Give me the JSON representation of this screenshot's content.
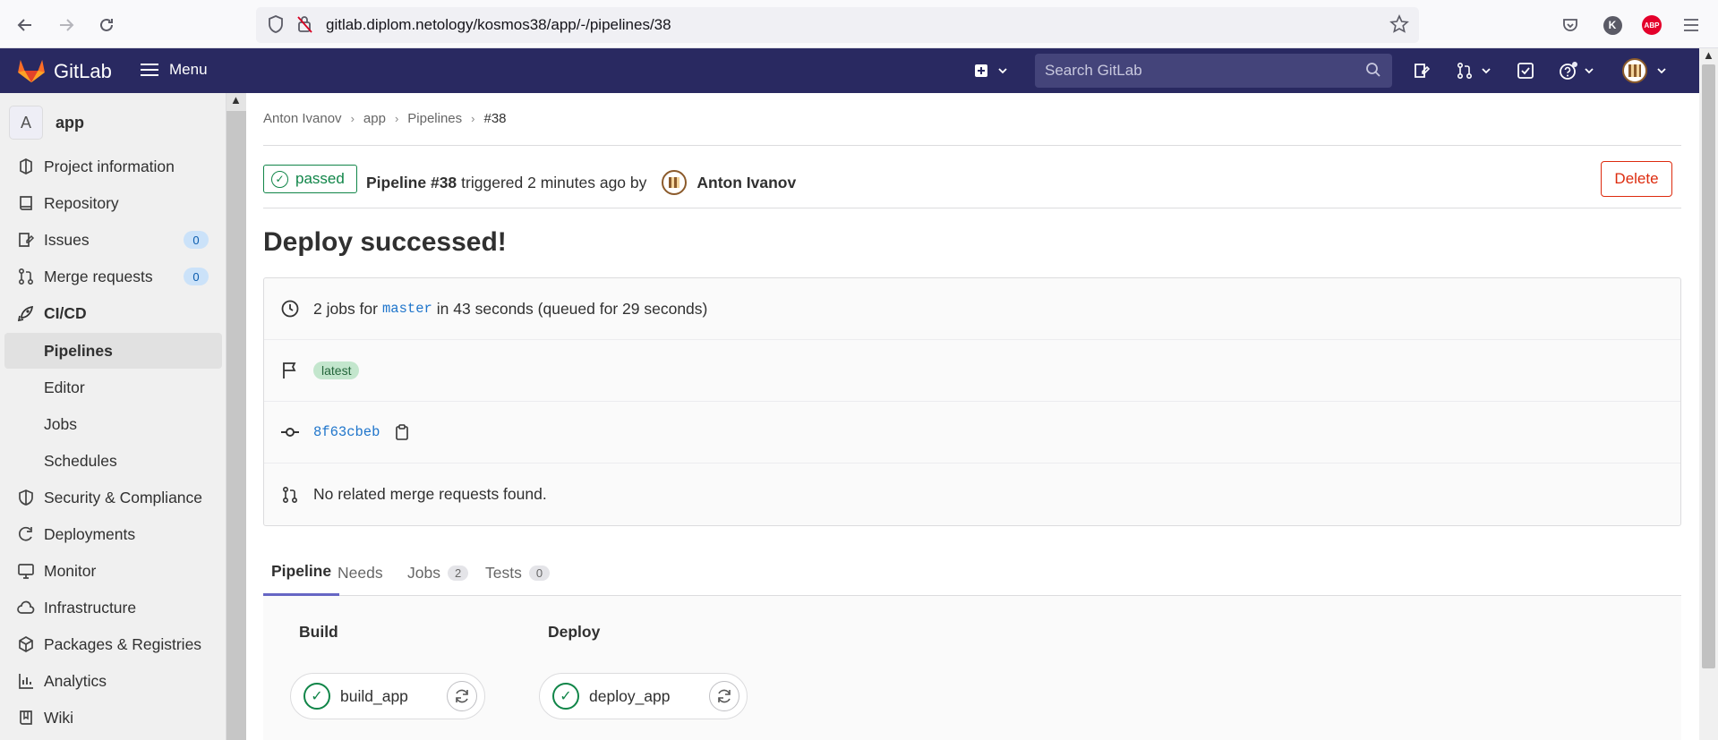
{
  "browser": {
    "url": "gitlab.diplom.netology/kosmos38/app/-/pipelines/38",
    "profile_initial": "K",
    "adblock_label": "ABP"
  },
  "header": {
    "brand": "GitLab",
    "menu_label": "Menu",
    "search_placeholder": "Search GitLab",
    "colors": {
      "bg": "#292961",
      "search_bg": "#44447a"
    }
  },
  "sidebar": {
    "project_initial": "A",
    "project_name": "app",
    "items": [
      {
        "label": "Project information",
        "icon": "project-info-icon"
      },
      {
        "label": "Repository",
        "icon": "repository-icon"
      },
      {
        "label": "Issues",
        "icon": "issues-icon",
        "badge": "0"
      },
      {
        "label": "Merge requests",
        "icon": "merge-request-icon",
        "badge": "0"
      },
      {
        "label": "CI/CD",
        "icon": "rocket-icon"
      },
      {
        "label": "Pipelines"
      },
      {
        "label": "Editor"
      },
      {
        "label": "Jobs"
      },
      {
        "label": "Schedules"
      },
      {
        "label": "Security & Compliance",
        "icon": "shield-icon"
      },
      {
        "label": "Deployments",
        "icon": "deployments-icon"
      },
      {
        "label": "Monitor",
        "icon": "monitor-icon"
      },
      {
        "label": "Infrastructure",
        "icon": "infrastructure-icon"
      },
      {
        "label": "Packages & Registries",
        "icon": "package-icon"
      },
      {
        "label": "Analytics",
        "icon": "analytics-icon"
      },
      {
        "label": "Wiki",
        "icon": "book-icon"
      }
    ]
  },
  "breadcrumb": [
    "Anton Ivanov",
    "app",
    "Pipelines",
    "#38"
  ],
  "pipeline": {
    "status": "passed",
    "title": "Pipeline #38",
    "triggered_text": "triggered 2 minutes ago by",
    "user": "Anton Ivanov",
    "delete_label": "Delete",
    "heading": "Deploy successed!",
    "jobs_prefix": "2 jobs for",
    "branch": "master",
    "jobs_suffix": "in 43 seconds (queued for 29 seconds)",
    "tag": "latest",
    "commit": "8f63cbeb",
    "merge_requests": "No related merge requests found."
  },
  "tabs": [
    {
      "label": "Pipeline"
    },
    {
      "label": "Needs"
    },
    {
      "label": "Jobs",
      "count": "2"
    },
    {
      "label": "Tests",
      "count": "0"
    }
  ],
  "stages": [
    {
      "name": "Build",
      "job": "build_app"
    },
    {
      "name": "Deploy",
      "job": "deploy_app"
    }
  ],
  "colors": {
    "success": "#108548",
    "danger": "#dd2b0e",
    "link": "#1f75cb"
  }
}
